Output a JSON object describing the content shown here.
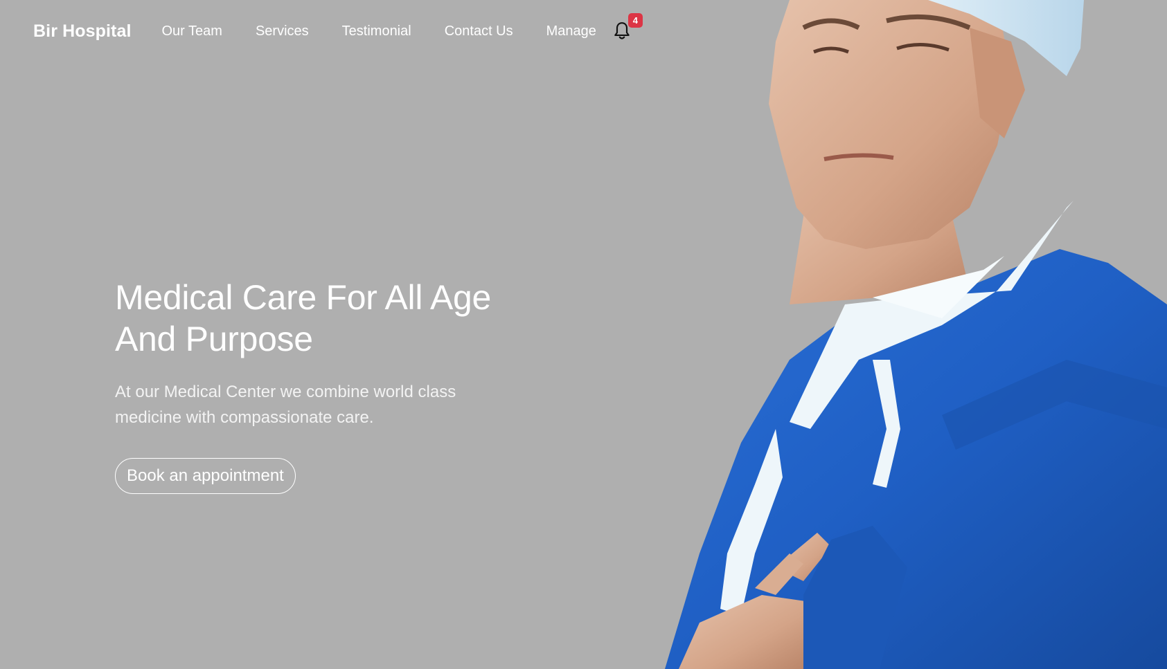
{
  "brand": {
    "name": "Bir Hospital"
  },
  "nav": {
    "items": [
      {
        "label": "Our Team"
      },
      {
        "label": "Services"
      },
      {
        "label": "Testimonial"
      },
      {
        "label": "Contact Us"
      },
      {
        "label": "Manage"
      }
    ],
    "notifications": {
      "icon": "bell-icon",
      "count": "4"
    }
  },
  "hero": {
    "title_line1": "Medical Care For All Age",
    "title_line2": "And Purpose",
    "description_line1": "At our Medical Center we combine world class",
    "description_line2": "medicine with compassionate care.",
    "cta_label": "Book an appointment"
  },
  "colors": {
    "background": "#afafaf",
    "text": "#ffffff",
    "badge": "#dc3545",
    "scrubs": "#1f5fc4"
  }
}
